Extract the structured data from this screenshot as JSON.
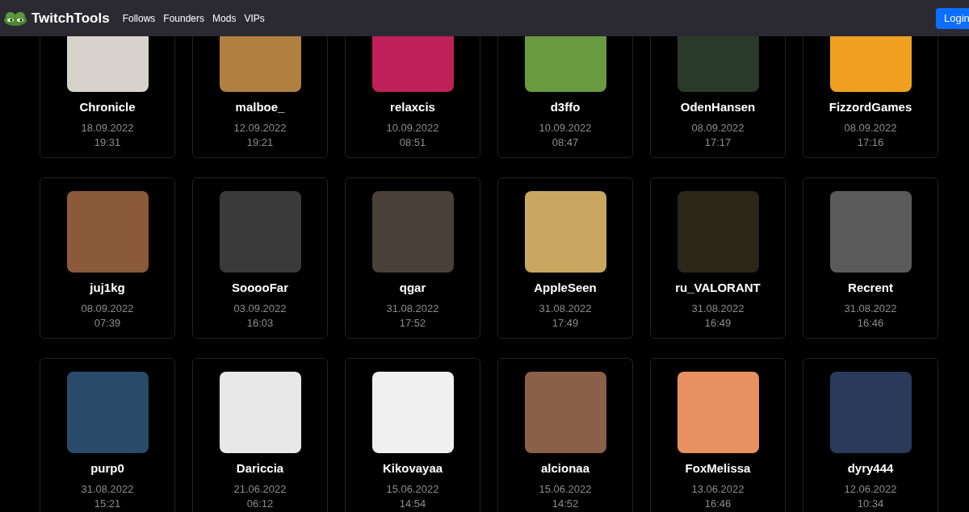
{
  "navbar": {
    "brand": "TwitchTools",
    "links": [
      "Follows",
      "Founders",
      "Mods",
      "VIPs"
    ],
    "login": "Login"
  },
  "users": [
    {
      "name": "Chronicle",
      "date": "18.09.2022",
      "time": "19:31",
      "color": "#d8d2cc"
    },
    {
      "name": "malboe_",
      "date": "12.09.2022",
      "time": "19:21",
      "color": "#b08040"
    },
    {
      "name": "relaxcis",
      "date": "10.09.2022",
      "time": "08:51",
      "color": "#c0205a"
    },
    {
      "name": "d3ffo",
      "date": "10.09.2022",
      "time": "08:47",
      "color": "#6a9a40"
    },
    {
      "name": "OdenHansen",
      "date": "08.09.2022",
      "time": "17:17",
      "color": "#2a3a2a"
    },
    {
      "name": "FizzordGames",
      "date": "08.09.2022",
      "time": "17:16",
      "color": "#f0a020"
    },
    {
      "name": "juj1kg",
      "date": "08.09.2022",
      "time": "07:39",
      "color": "#8a5a3a"
    },
    {
      "name": "SooooFar",
      "date": "03.09.2022",
      "time": "16:03",
      "color": "#3a3a3a"
    },
    {
      "name": "qgar",
      "date": "31.08.2022",
      "time": "17:52",
      "color": "#4a4038"
    },
    {
      "name": "AppleSeen",
      "date": "31.08.2022",
      "time": "17:49",
      "color": "#c8a860"
    },
    {
      "name": "ru_VALORANT",
      "date": "31.08.2022",
      "time": "16:49",
      "color": "#2a2618"
    },
    {
      "name": "Recrent",
      "date": "31.08.2022",
      "time": "16:46",
      "color": "#5a5a5a"
    },
    {
      "name": "purp0",
      "date": "31.08.2022",
      "time": "15:21",
      "color": "#2a4a6a"
    },
    {
      "name": "Dariccia",
      "date": "21.06.2022",
      "time": "06:12",
      "color": "#e8e8e8"
    },
    {
      "name": "Kikovayaa",
      "date": "15.06.2022",
      "time": "14:54",
      "color": "#f0f0f0"
    },
    {
      "name": "alcionaa",
      "date": "15.06.2022",
      "time": "14:52",
      "color": "#8a6048"
    },
    {
      "name": "FoxMelissa",
      "date": "13.06.2022",
      "time": "16:46",
      "color": "#e89060"
    },
    {
      "name": "dyry444",
      "date": "12.06.2022",
      "time": "10:34",
      "color": "#2a3a5a"
    }
  ]
}
